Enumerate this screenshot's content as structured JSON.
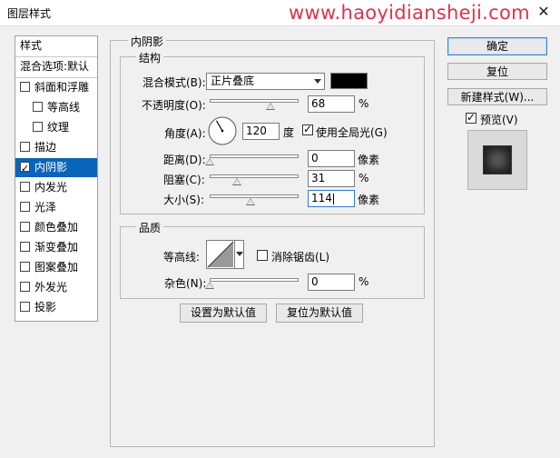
{
  "window": {
    "title": "图层样式",
    "watermark": "www.haoyidiansheji.com",
    "close": "✕"
  },
  "left_panel": {
    "header": "样式",
    "blend_options": "混合选项:默认",
    "items": [
      {
        "label": "斜面和浮雕",
        "checked": false,
        "indent": false
      },
      {
        "label": "等高线",
        "checked": false,
        "indent": true
      },
      {
        "label": "纹理",
        "checked": false,
        "indent": true
      },
      {
        "label": "描边",
        "checked": false,
        "indent": false
      },
      {
        "label": "内阴影",
        "checked": true,
        "indent": false,
        "selected": true
      },
      {
        "label": "内发光",
        "checked": false,
        "indent": false
      },
      {
        "label": "光泽",
        "checked": false,
        "indent": false
      },
      {
        "label": "颜色叠加",
        "checked": false,
        "indent": false
      },
      {
        "label": "渐变叠加",
        "checked": false,
        "indent": false
      },
      {
        "label": "图案叠加",
        "checked": false,
        "indent": false
      },
      {
        "label": "外发光",
        "checked": false,
        "indent": false
      },
      {
        "label": "投影",
        "checked": false,
        "indent": false
      }
    ]
  },
  "panel": {
    "title": "内阴影",
    "structure": {
      "legend": "结构",
      "blend_mode_label": "混合模式(B):",
      "blend_mode_value": "正片叠底",
      "blend_color": "#000000",
      "opacity_label": "不透明度(O):",
      "opacity_value": "68",
      "opacity_unit": "%",
      "opacity": 68,
      "angle_label": "角度(A):",
      "angle_value": "120",
      "angle_unit": "度",
      "angle_deg": 120,
      "global_light_label": "使用全局光(G)",
      "global_light": true,
      "distance_label": "距离(D):",
      "distance_value": "0",
      "distance_unit": "像素",
      "distance": 0,
      "choke_label": "阻塞(C):",
      "choke_value": "31",
      "choke_unit": "%",
      "choke": 31,
      "size_label": "大小(S):",
      "size_value": "114",
      "size_unit": "像素",
      "size": 114,
      "size_max": 250
    },
    "quality": {
      "legend": "品质",
      "contour_label": "等高线:",
      "antialias_label": "消除锯齿(L)",
      "antialias": false,
      "noise_label": "杂色(N):",
      "noise_value": "0",
      "noise_unit": "%",
      "noise": 0
    },
    "buttons": {
      "set_default": "设置为默认值",
      "reset_default": "复位为默认值"
    }
  },
  "right": {
    "ok": "确定",
    "reset": "复位",
    "new_style": "新建样式(W)...",
    "preview_label": "预览(V)",
    "preview": true
  },
  "colors": {
    "accent": "#0a64ba",
    "watermark": "#e0314a"
  }
}
